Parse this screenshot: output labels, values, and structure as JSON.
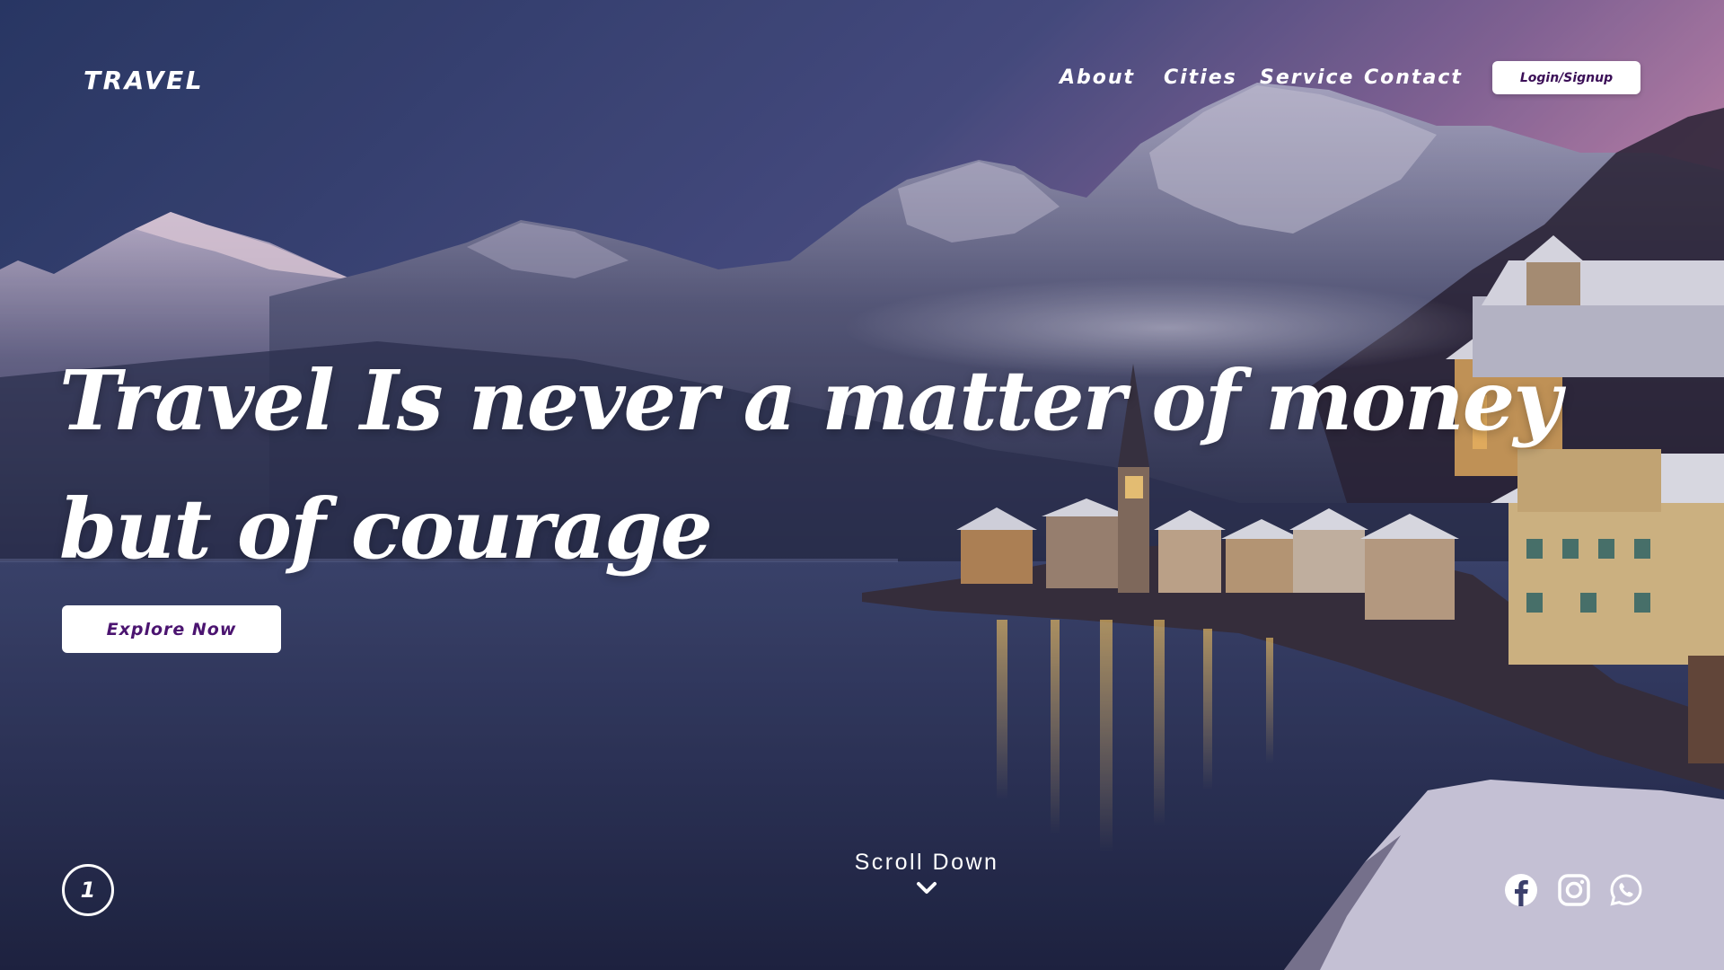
{
  "header": {
    "logo": "TRAVEL",
    "nav": [
      {
        "label": "About"
      },
      {
        "label": "Cities"
      },
      {
        "label": "Service"
      },
      {
        "label": "Contact"
      }
    ],
    "login_label": "Login/Signup"
  },
  "hero": {
    "line1": "Travel Is never a matter of money",
    "line2": "but of courage",
    "cta_label": "Explore Now"
  },
  "footer": {
    "page_number": "1",
    "scroll_label": "Scroll Down",
    "social_icons": [
      "facebook-icon",
      "instagram-icon",
      "whatsapp-icon"
    ]
  },
  "colors": {
    "sky_top": "#2e3e6e",
    "sky_pink": "#c38bb6",
    "water": "#2d3557",
    "accent_purple": "#4b1470",
    "button_bg": "#ffffff"
  }
}
